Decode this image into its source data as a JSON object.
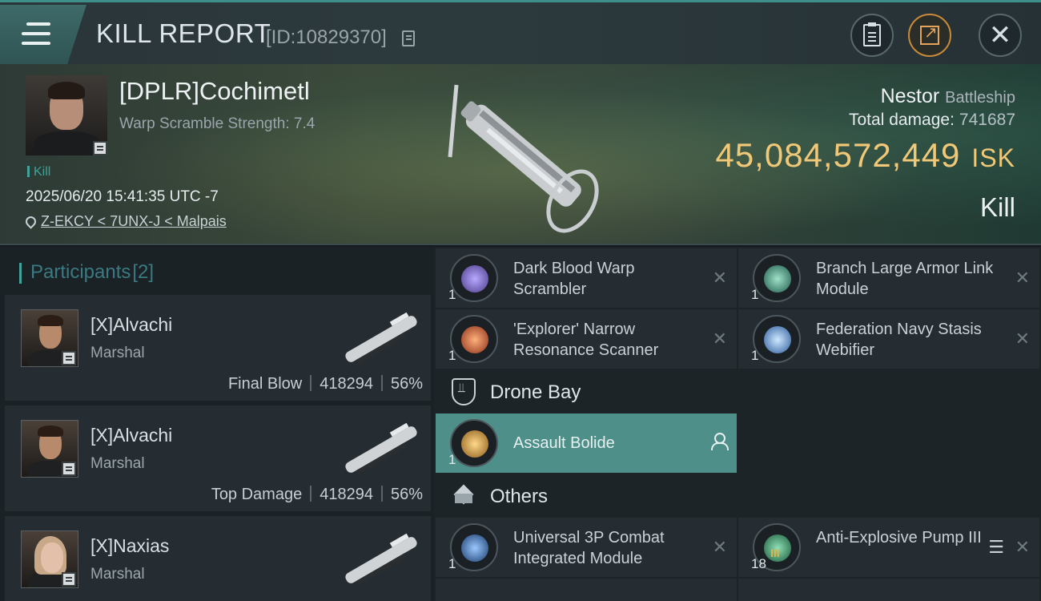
{
  "topbar": {
    "title": "KILL REPORT",
    "report_id": "[ID:10829370]"
  },
  "victim": {
    "name": "[DPLR]Cochimetl",
    "warp_scramble": "Warp Scramble Strength: 7.4",
    "kill_tag": "Kill",
    "datetime": "2025/06/20 15:41:35 UTC -7",
    "location": "Z-EKCY < 7UNX-J < Malpais",
    "ship_name": "Nestor",
    "ship_class": "Battleship",
    "total_damage_label": "Total damage:",
    "total_damage": "741687",
    "isk_value": "45,084,572,449",
    "isk_unit": "ISK",
    "result": "Kill"
  },
  "participants": {
    "label": "Participants",
    "count": "[2]",
    "rows": [
      {
        "name": "[X]Alvachi",
        "rank": "Marshal",
        "role": "Final Blow",
        "damage": "418294",
        "percent": "56%"
      },
      {
        "name": "[X]Alvachi",
        "rank": "Marshal",
        "role": "Top Damage",
        "damage": "418294",
        "percent": "56%"
      },
      {
        "name": "[X]Naxias",
        "rank": "Marshal"
      }
    ]
  },
  "modules": {
    "high": [
      {
        "qty": "1",
        "name": "Dark Blood Warp Scrambler",
        "icon": "warp-scrambler-icon",
        "color": "#8a7ad8"
      },
      {
        "qty": "1",
        "name": "Branch Large Armor Link Module",
        "icon": "armor-link-icon",
        "color": "#3a8f7a"
      },
      {
        "qty": "1",
        "name": "'Explorer' Narrow Resonance Scanner",
        "icon": "scanner-icon",
        "color": "#d8673a"
      },
      {
        "qty": "1",
        "name": "Federation Navy Stasis Webifier",
        "icon": "webifier-icon",
        "color": "#6aa6e0"
      }
    ],
    "drone_bay_label": "Drone Bay",
    "drones": [
      {
        "qty": "1",
        "name": "Assault Bolide",
        "icon": "drone-icon",
        "color": "#d8a23a"
      }
    ],
    "others_label": "Others",
    "others": [
      {
        "qty": "1",
        "name": "Universal 3P Combat Integrated Module",
        "icon": "combat-module-icon",
        "color": "#3a6fa8"
      },
      {
        "qty": "18",
        "name": "Anti-Explosive Pump III",
        "icon": "rig-icon",
        "color": "#3a8f6a",
        "tier": "III"
      }
    ]
  }
}
